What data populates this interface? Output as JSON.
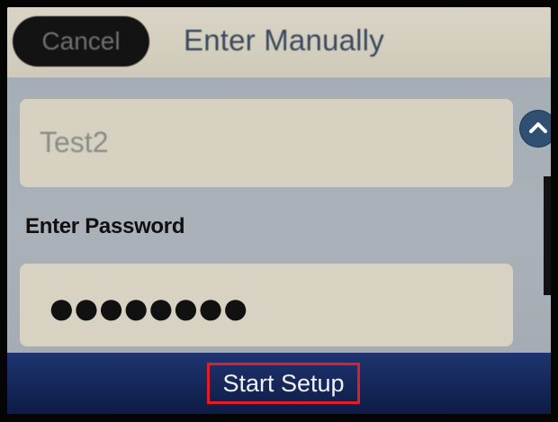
{
  "header": {
    "cancel_label": "Cancel",
    "title": "Enter Manually"
  },
  "ssid": {
    "value": "Test2"
  },
  "password": {
    "label": "Enter Password",
    "masked_value": "●●●●●●●●"
  },
  "footer": {
    "start_label": "Start Setup"
  },
  "icons": {
    "scroll_up": "chevron-up-icon"
  },
  "colors": {
    "header_bg": "#d9d4c5",
    "content_bg": "#a9b0b8",
    "footer_bg": "#1f3470",
    "highlight": "#e21c28",
    "scroll_button": "#2f4f73"
  }
}
